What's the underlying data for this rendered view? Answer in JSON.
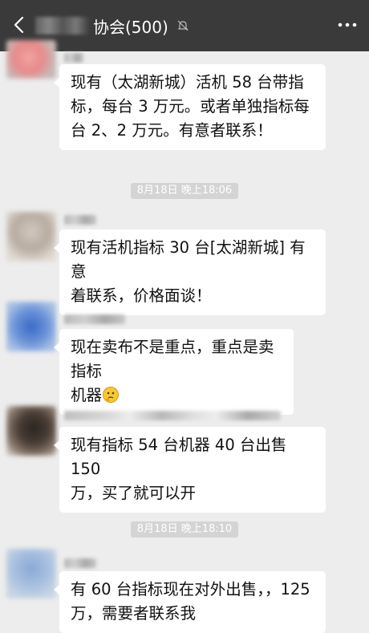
{
  "header": {
    "title": "协会(500)",
    "icons": {
      "back": "chevron-left-icon",
      "mute": "bell-mute-icon",
      "more": "more-dots-icon"
    }
  },
  "messages": [
    {
      "text": "现有（太湖新城）活机 58 台带指标，每台 3 万元。或者单独指标每台 2、2 万元。有意者联系！",
      "lines": [
        "现有（太湖新城）活机 58 台带指",
        "标，每台 3 万元。或者单独指标每",
        "台 2、2 万元。有意者联系！"
      ]
    },
    {
      "text": "现有活机指标 30 台[太湖新城] 有意着联系，价格面谈！",
      "lines": [
        "现有活机指标 30 台[太湖新城] 有意",
        "着联系，价格面谈！"
      ]
    },
    {
      "text": "现在卖布不是重点，重点是卖指标机器",
      "lines": [
        "现在卖布不是重点，重点是卖指标",
        "机器"
      ],
      "emoji": "thinking-face-emoji"
    },
    {
      "text": "现有指标 54 台机器 40 台出售 150 万，买了就可以开",
      "lines": [
        "现有指标 54 台机器 40 台出售 150",
        "万，买了就可以开"
      ]
    },
    {
      "text": "有 60 台指标现在对外出售，，125 万，需要者联系我",
      "lines": [
        "有 60 台指标现在对外出售，，125",
        "万，需要者联系我"
      ]
    }
  ],
  "timestamps": [
    "8月18日  晚上18:06",
    "8月18日  晚上18:10"
  ],
  "colors": {
    "topbar": "#3a3a3a",
    "background": "#ededed",
    "bubble": "#ffffff",
    "timestamp_bg": "#d4d4d4"
  }
}
